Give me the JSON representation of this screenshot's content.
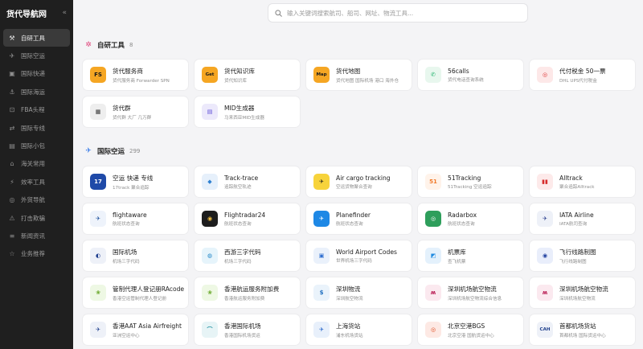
{
  "app": {
    "title": "货代导航网",
    "collapse_icon": "chevrons-left-icon"
  },
  "search": {
    "placeholder": "输入关键词搜索航司、船司、网址、物流工具..."
  },
  "sidebar": {
    "items": [
      {
        "label": "自研工具",
        "icon": "tool-icon",
        "active": true
      },
      {
        "label": "国际空运",
        "icon": "plane-icon"
      },
      {
        "label": "国际快递",
        "icon": "box-icon"
      },
      {
        "label": "国际海运",
        "icon": "ship-icon"
      },
      {
        "label": "FBA头程",
        "icon": "cart-icon"
      },
      {
        "label": "国际专线",
        "icon": "route-icon"
      },
      {
        "label": "国际小包",
        "icon": "package-icon"
      },
      {
        "label": "海关常用",
        "icon": "customs-icon"
      },
      {
        "label": "效率工具",
        "icon": "lightning-icon"
      },
      {
        "label": "外贸导航",
        "icon": "globe-icon"
      },
      {
        "label": "打击欺骗",
        "icon": "warning-icon"
      },
      {
        "label": "新闻资讯",
        "icon": "news-icon"
      },
      {
        "label": "业务推荐",
        "icon": "star-icon"
      }
    ]
  },
  "sections": [
    {
      "title": "自研工具",
      "count": "8",
      "icon": "sparkle-icon",
      "icon_color": "#e0457b",
      "cards": [
        {
          "name": "货代服务商",
          "desc": "货代服务商 Forwarder SPN",
          "logo_text": "FS",
          "logo_bg": "#f5a623",
          "logo_fg": "#1a1a1a"
        },
        {
          "name": "货代知识库",
          "desc": "货代知识库",
          "logo_text": "Get",
          "logo_bg": "#f5a623",
          "logo_fg": "#1a1a1a"
        },
        {
          "name": "货代地图",
          "desc": "货代地图 国际机场 港口 海外仓",
          "logo_text": "Map",
          "logo_bg": "#f5a623",
          "logo_fg": "#1a1a1a"
        },
        {
          "name": "56calls",
          "desc": "货代电话查询系统",
          "logo_text": "✆",
          "logo_bg": "#e8f7ee",
          "logo_fg": "#2bb673"
        },
        {
          "name": "代付税金 50一票",
          "desc": "DHL UPS代付税金",
          "logo_text": "◎",
          "logo_bg": "#fde8e8",
          "logo_fg": "#d33"
        },
        {
          "name": "货代群",
          "desc": "货代群 大厂 几万群",
          "logo_text": "▦",
          "logo_bg": "#eeeeee",
          "logo_fg": "#333"
        },
        {
          "name": "MID生成器",
          "desc": "马来西亚MID生成器",
          "logo_text": "▤",
          "logo_bg": "#ece9fb",
          "logo_fg": "#5b4bd6"
        }
      ]
    },
    {
      "title": "国际空运",
      "count": "299",
      "icon": "plane-icon",
      "icon_color": "#3b7de8",
      "cards": [
        {
          "name": "空运 快递 专线",
          "desc": "17track 聚合追踪",
          "logo_text": "17",
          "logo_bg": "#1f4aa8",
          "logo_fg": "#ffffff"
        },
        {
          "name": "Track-trace",
          "desc": "追踪航空轨迹",
          "logo_text": "◆",
          "logo_bg": "#e6f0fb",
          "logo_fg": "#2f80d1"
        },
        {
          "name": "Air cargo tracking",
          "desc": "空运货物聚合查询",
          "logo_text": "✈",
          "logo_bg": "#f7d33b",
          "logo_fg": "#1a1a1a"
        },
        {
          "name": "51Tracking",
          "desc": "51Tracking 空运追踪",
          "logo_text": "51",
          "logo_bg": "#fff3ea",
          "logo_fg": "#f07a2a"
        },
        {
          "name": "Alltrack",
          "desc": "聚合追踪Alltrack",
          "logo_text": "▮▮",
          "logo_bg": "#fdeaea",
          "logo_fg": "#d62c2c"
        },
        {
          "name": "flightaware",
          "desc": "航班状态查询",
          "logo_text": "✈",
          "logo_bg": "#eef3fb",
          "logo_fg": "#1b4f9c"
        },
        {
          "name": "Flightradar24",
          "desc": "航班状态查询",
          "logo_text": "◉",
          "logo_bg": "#1d1d1d",
          "logo_fg": "#f6c343"
        },
        {
          "name": "Planefinder",
          "desc": "航班状态查询",
          "logo_text": "✈",
          "logo_bg": "#1e88e5",
          "logo_fg": "#ffffff"
        },
        {
          "name": "Radarbox",
          "desc": "航班状态查询",
          "logo_text": "◎",
          "logo_bg": "#2e9e5b",
          "logo_fg": "#ffffff"
        },
        {
          "name": "IATA Airline",
          "desc": "IATA航司查询",
          "logo_text": "✈",
          "logo_bg": "#eef1f8",
          "logo_fg": "#2a3f8f"
        },
        {
          "name": "国际机场",
          "desc": "机场三字代码",
          "logo_text": "◐",
          "logo_bg": "#eef1f8",
          "logo_fg": "#1f3f8f"
        },
        {
          "name": "西游三字代码",
          "desc": "机场三字代码",
          "logo_text": "◍",
          "logo_bg": "#e6f4fb",
          "logo_fg": "#2386c8"
        },
        {
          "name": "World Airport Codes",
          "desc": "世界机场三字代码",
          "logo_text": "▣",
          "logo_bg": "#eaf1fb",
          "logo_fg": "#2f6fd0"
        },
        {
          "name": "机票库",
          "desc": "查飞机票",
          "logo_text": "◩",
          "logo_bg": "#e4f1fc",
          "logo_fg": "#1f8ae0"
        },
        {
          "name": "飞行线路制图",
          "desc": "飞行线路制图",
          "logo_text": "◉",
          "logo_bg": "#e9eefb",
          "logo_fg": "#1f3f9f"
        },
        {
          "name": "管制代理人登记册RAcode",
          "desc": "香港空运管制代理人登记册",
          "logo_text": "❀",
          "logo_bg": "#eef8e4",
          "logo_fg": "#6aa82a"
        },
        {
          "name": "香港航运服务附加费",
          "desc": "香港航运服务附加费",
          "logo_text": "❀",
          "logo_bg": "#eef8e4",
          "logo_fg": "#6aa82a"
        },
        {
          "name": "深圳物流",
          "desc": "深圳航空物流",
          "logo_text": "$",
          "logo_bg": "#eaf3fb",
          "logo_fg": "#1f6fc0"
        },
        {
          "name": "深圳机场航空物流",
          "desc": "深圳机场航空物流综合信息",
          "logo_text": "ʍ",
          "logo_bg": "#fbe9ef",
          "logo_fg": "#b8174f"
        },
        {
          "name": "深圳机场航空物流",
          "desc": "深圳机场航空物流",
          "logo_text": "ʍ",
          "logo_bg": "#fbe9ef",
          "logo_fg": "#b8174f"
        },
        {
          "name": "香港AAT Asia Airfreight",
          "desc": "亚洲空运中心",
          "logo_text": "✈",
          "logo_bg": "#eef1f8",
          "logo_fg": "#1d3e8c"
        },
        {
          "name": "香港国际机场",
          "desc": "香港国际机场货运",
          "logo_text": "⌒",
          "logo_bg": "#e7f4f6",
          "logo_fg": "#1c8fa0"
        },
        {
          "name": "上海货站",
          "desc": "浦东机场货站",
          "logo_text": "✈",
          "logo_bg": "#e8f0fb",
          "logo_fg": "#1f5fc8"
        },
        {
          "name": "北京空港BGS",
          "desc": "北京空港 国航货运中心",
          "logo_text": "◎",
          "logo_bg": "#fde9e4",
          "logo_fg": "#e04b1f"
        },
        {
          "name": "首都机场货站",
          "desc": "首都机场 国际货运中心",
          "logo_text": "CAH",
          "logo_bg": "#eef1f8",
          "logo_fg": "#1d3e8c"
        }
      ]
    }
  ]
}
